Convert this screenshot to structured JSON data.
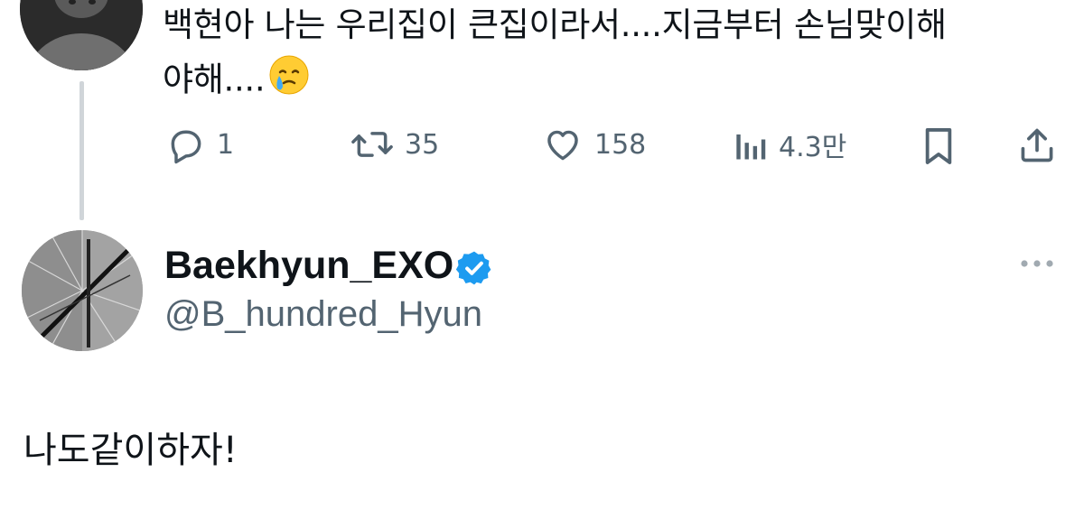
{
  "parent_tweet": {
    "text_line1": "백현아 나는 우리집이 큰집이라서....지금부터 손님맞이해",
    "text_line2": "야해....",
    "emoji": "face-holding-back-tears",
    "reply_count": "1",
    "retweet_count": "35",
    "like_count": "158",
    "view_count": "4.3만",
    "icons": {
      "reply": "reply-icon",
      "retweet": "retweet-icon",
      "like": "heart-icon",
      "views": "views-icon",
      "bookmark": "bookmark-icon",
      "share": "share-icon"
    }
  },
  "reply_tweet": {
    "display_name": "Baekhyun_EXO",
    "handle": "@B_hundred_Hyun",
    "verified": true,
    "text": "나도같이하자!",
    "more_icon": "more-dots-icon"
  },
  "colors": {
    "text_primary": "#0f1419",
    "text_secondary": "#536471",
    "verified_blue": "#1d9bf0",
    "thread_line": "#d0d5d9"
  }
}
